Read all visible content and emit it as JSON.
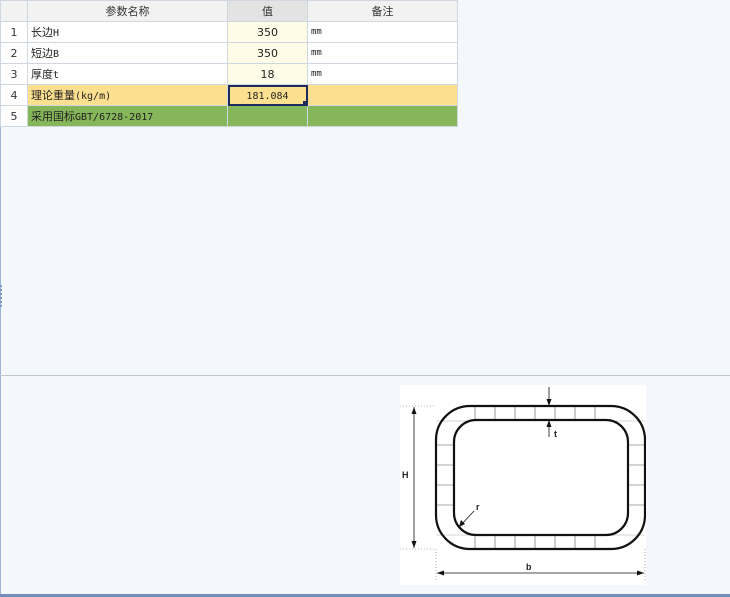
{
  "table": {
    "headers": {
      "name": "参数名称",
      "value": "值",
      "note": "备注"
    },
    "rows": [
      {
        "num": "1",
        "name_main": "长边",
        "name_sym": "H",
        "value": "350",
        "note": "mm"
      },
      {
        "num": "2",
        "name_main": "短边",
        "name_sym": "B",
        "value": "350",
        "note": "mm"
      },
      {
        "num": "3",
        "name_main": "厚度",
        "name_sym": "t",
        "value": "18",
        "note": "mm"
      },
      {
        "num": "4",
        "name_main": "理论重量",
        "name_sym": "(kg/m)",
        "value": "181.084",
        "note": ""
      },
      {
        "num": "5",
        "name_main": "采用国标",
        "name_sym": "GBT/6728-2017",
        "value": "",
        "note": ""
      }
    ]
  },
  "diagram": {
    "label_H": "H",
    "label_b": "b",
    "label_t": "t",
    "label_r": "r"
  }
}
